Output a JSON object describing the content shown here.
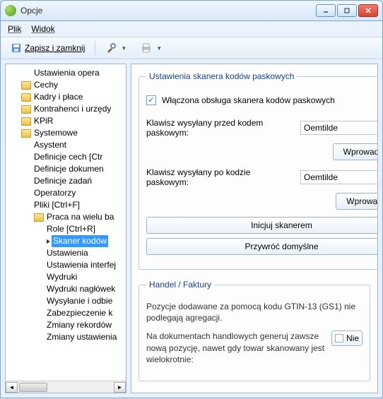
{
  "window": {
    "title": "Opcje"
  },
  "menu": {
    "file": "Plik",
    "view": "Widok"
  },
  "toolbar": {
    "save_close": "Zapisz i zamknij"
  },
  "tree": {
    "items": [
      {
        "label": "Ustawienia opera",
        "depth": "ind2"
      },
      {
        "label": "Cechy",
        "depth": "ind1",
        "folder": true
      },
      {
        "label": "Kadry i płace",
        "depth": "ind1",
        "folder": true
      },
      {
        "label": "Kontrahenci i urzędy",
        "depth": "ind1",
        "folder": true
      },
      {
        "label": "KPiR",
        "depth": "ind1",
        "folder": true
      },
      {
        "label": "Systemowe",
        "depth": "ind1",
        "folder": true
      },
      {
        "label": "Asystent",
        "depth": "ind2"
      },
      {
        "label": "Definicje cech [Ctr",
        "depth": "ind2"
      },
      {
        "label": "Definicje dokumen",
        "depth": "ind2"
      },
      {
        "label": "Definicje zadań",
        "depth": "ind2"
      },
      {
        "label": "Operatorzy",
        "depth": "ind2"
      },
      {
        "label": "Pliki [Ctrl+F]",
        "depth": "ind2"
      },
      {
        "label": "Praca na wielu ba",
        "depth": "ind3f",
        "folder": true
      },
      {
        "label": "Role [Ctrl+R]",
        "depth": "ind3"
      },
      {
        "label": "Skaner kodów",
        "depth": "ind3",
        "selected": true
      },
      {
        "label": "Ustawienia",
        "depth": "ind3"
      },
      {
        "label": "Ustawienia interfej",
        "depth": "ind3"
      },
      {
        "label": "Wydruki",
        "depth": "ind3"
      },
      {
        "label": "Wydruki nagłówek",
        "depth": "ind3"
      },
      {
        "label": "Wysyłanie i odbie",
        "depth": "ind3"
      },
      {
        "label": "Zabezpieczenie k",
        "depth": "ind3"
      },
      {
        "label": "Zmiany rekordów",
        "depth": "ind3"
      },
      {
        "label": "Zmiany ustawienia",
        "depth": "ind3"
      }
    ]
  },
  "settings": {
    "scanner": {
      "legend": "Ustawienia skanera kodów paskowych",
      "enable_label": "Włączona obsługa skanera kodów paskowych",
      "enable_checked": true,
      "key_before_label": "Klawisz wysyłany przed kodem paskowym:",
      "key_before_value": "Oemtilde",
      "prefix_btn": "Wprowadź prefix",
      "key_after_label": "Klawisz wysyłany po kodzie paskowym:",
      "key_after_value": "Oemtilde",
      "suffix_btn": "Wprowadź sufix",
      "init_btn": "Inicjuj skanerem",
      "restore_btn": "Przywróć domyślne"
    },
    "invoices": {
      "legend": "Handel / Faktury",
      "info1": "Pozycje dodawane za pomocą kodu GTIN-13 (GS1) nie podlegają agregacji.",
      "info2": "Na dokumentach handlowych generuj zawsze nową pozycję, nawet gdy towar skanowany jest wielokrotnie:",
      "toggle": "Nie"
    }
  }
}
